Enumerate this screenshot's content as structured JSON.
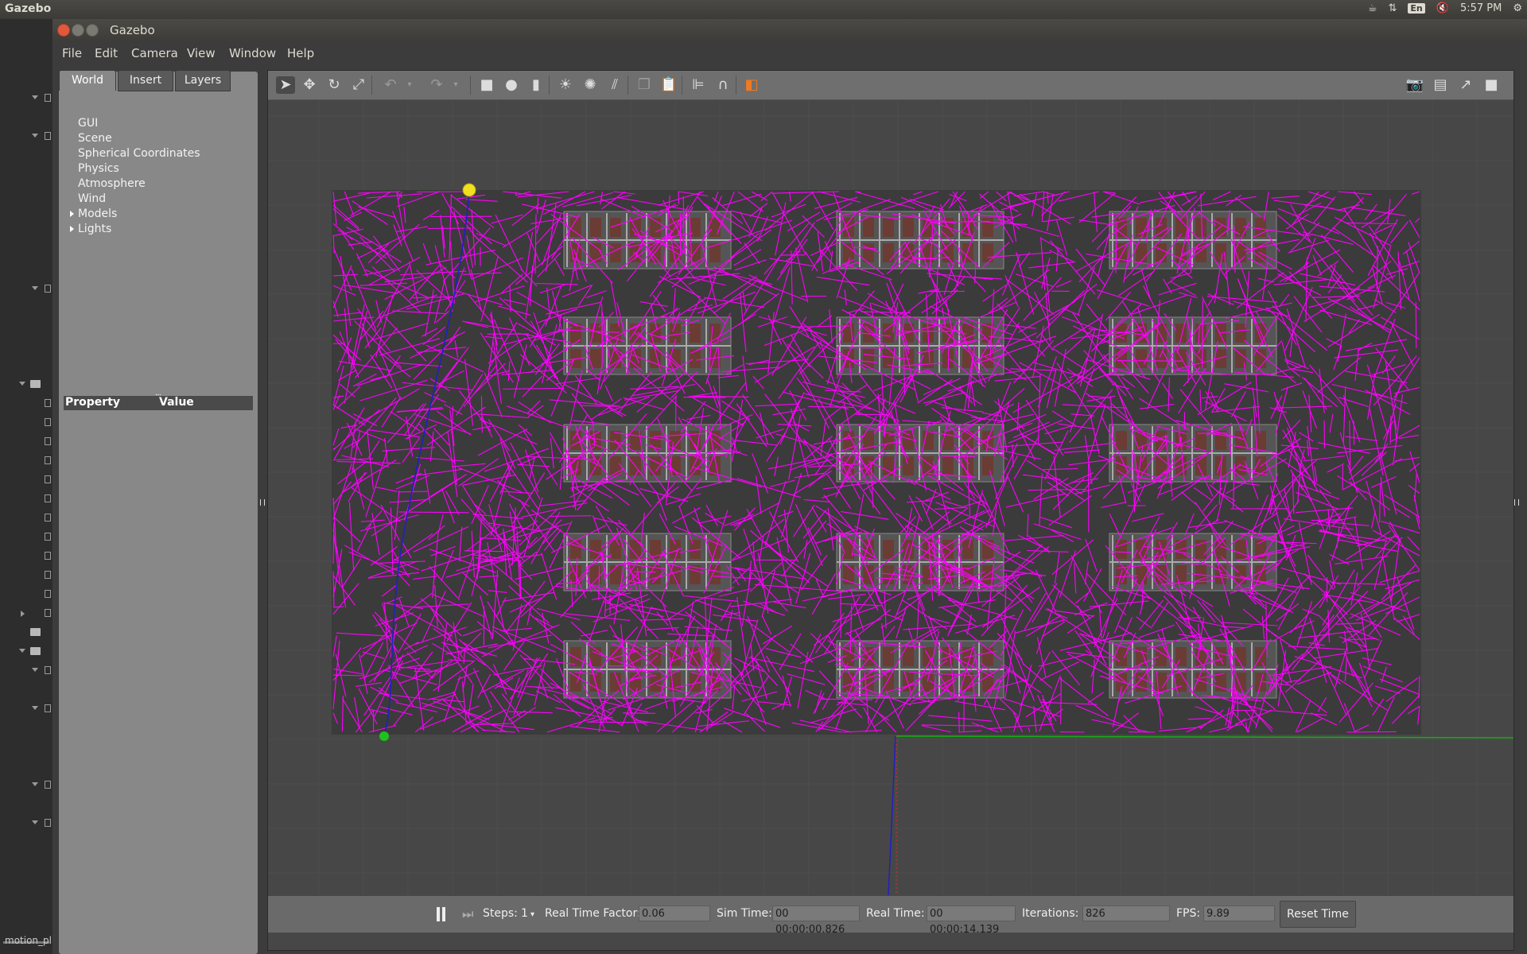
{
  "os_bar": {
    "app_name": "Gazebo",
    "input_method": "En",
    "clock": "5:57 PM"
  },
  "window": {
    "title": "Gazebo"
  },
  "menu": [
    "File",
    "Edit",
    "Camera",
    "View",
    "Window",
    "Help"
  ],
  "left_panel": {
    "tabs": [
      "World",
      "Insert",
      "Layers"
    ],
    "tree": [
      "GUI",
      "Scene",
      "Spherical Coordinates",
      "Physics",
      "Atmosphere",
      "Wind",
      "Models",
      "Lights"
    ],
    "property_header": "Property",
    "value_header": "Value"
  },
  "file_tree_footer": "motion_pl",
  "toolbar": {
    "tools": [
      "select-arrow",
      "translate-mode",
      "rotate-mode",
      "scale-mode",
      "undo",
      "redo",
      "box-shape",
      "sphere-shape",
      "cylinder-shape",
      "point-light",
      "spot-light",
      "directional-light",
      "copy",
      "paste",
      "align",
      "snap-magnet",
      "view-angle"
    ],
    "right_tools": [
      "screenshot-camera",
      "log-record",
      "plot",
      "video-record"
    ]
  },
  "status": {
    "steps_label": "Steps:",
    "steps_value": "1",
    "rtf_label": "Real Time Factor:",
    "rtf_value": "0.06",
    "sim_label": "Sim Time:",
    "sim_value": "00 00:00:00.826",
    "real_label": "Real Time:",
    "real_value": "00 00:00:14.139",
    "iter_label": "Iterations:",
    "iter_value": "826",
    "fps_label": "FPS:",
    "fps_value": "9.89",
    "reset_label": "Reset Time"
  },
  "colors": {
    "rrt_tree": "#ff00ff",
    "path": "#2020c0",
    "start_marker": "#f0e020",
    "goal_marker": "#20c020",
    "x_axis": "#10b010",
    "ground": "#474747"
  }
}
